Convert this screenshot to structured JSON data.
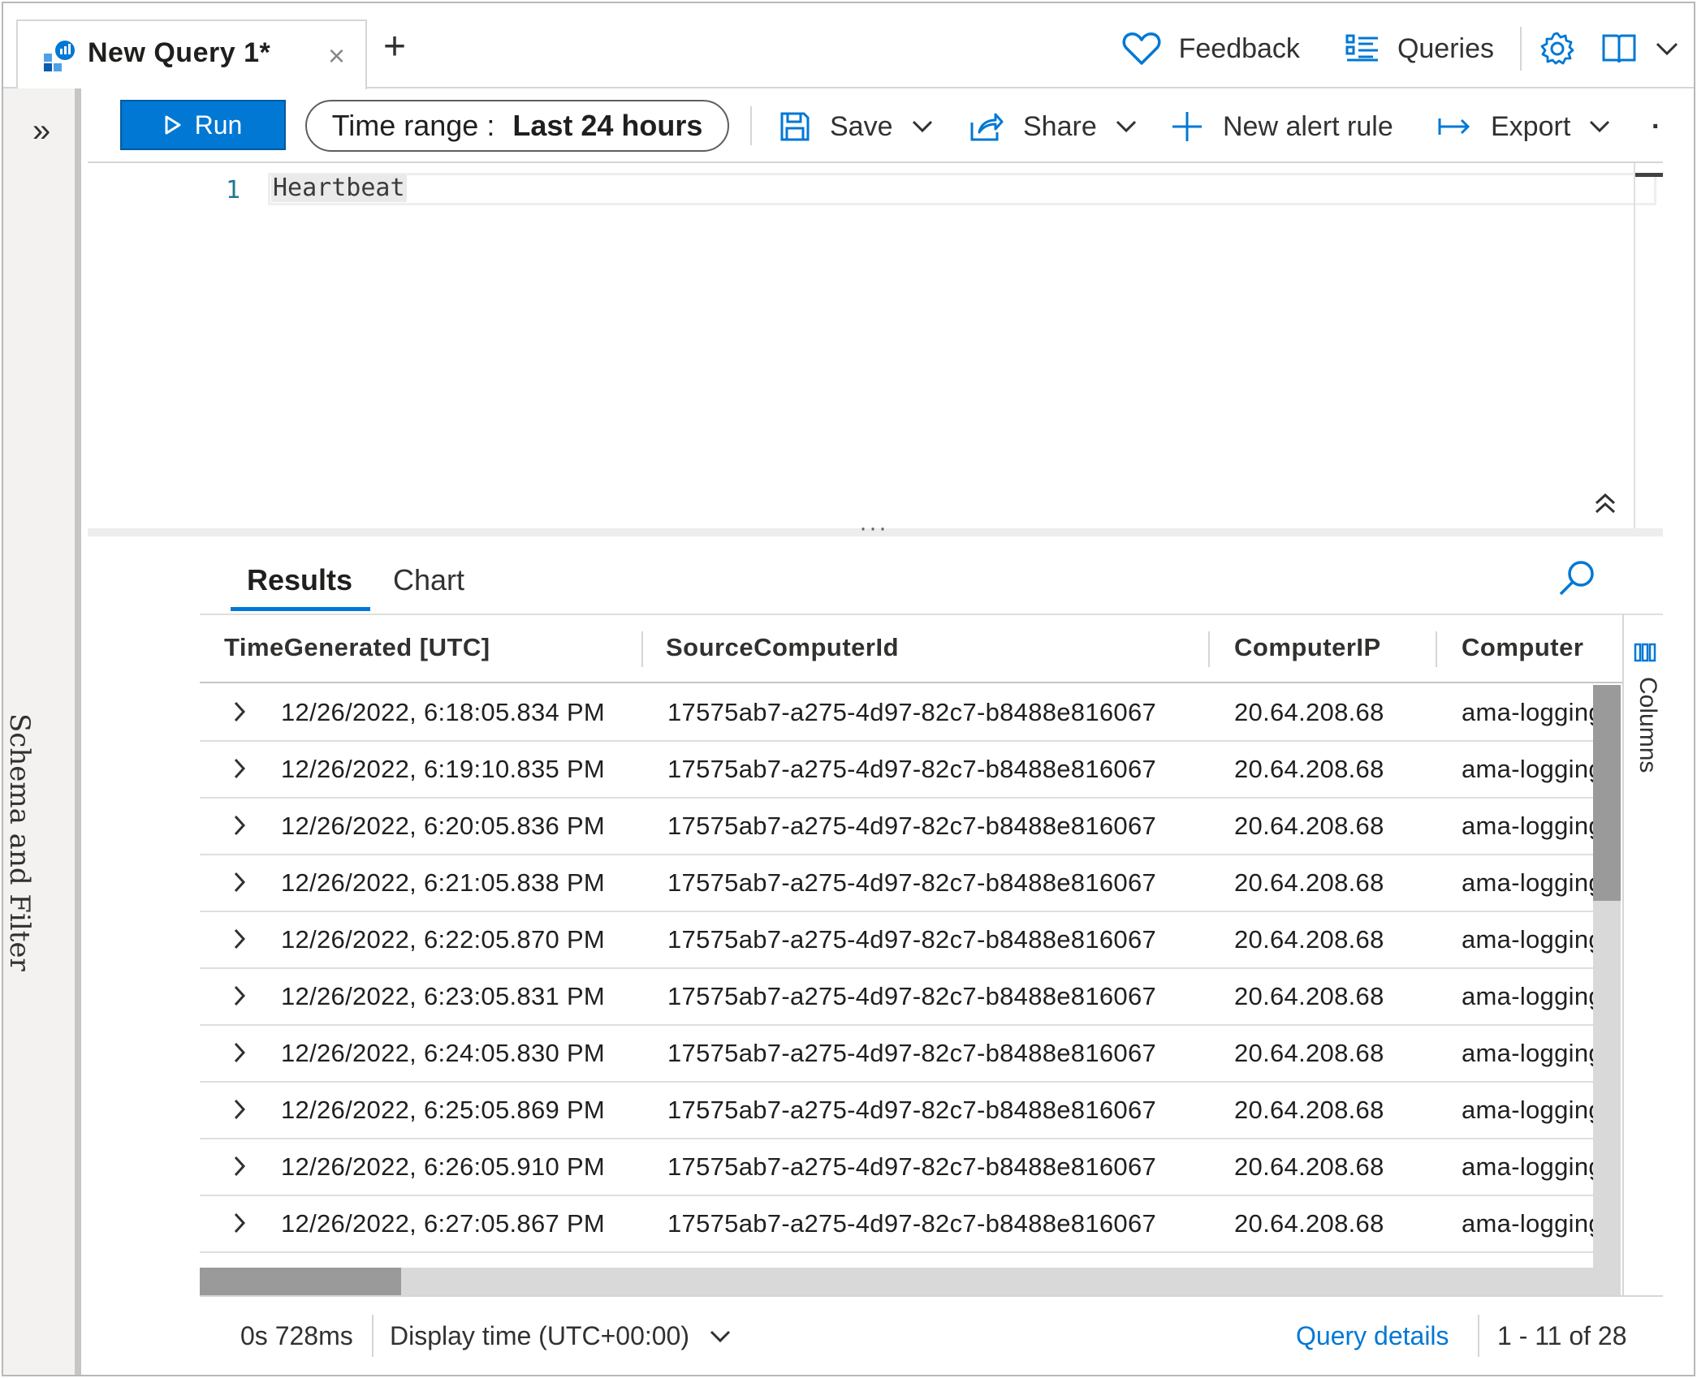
{
  "tab": {
    "title": "New Query 1*",
    "close": "×",
    "add": "+"
  },
  "top_actions": {
    "feedback": "Feedback",
    "queries": "Queries"
  },
  "left_panel": {
    "label": "Schema and Filter",
    "expand": "»"
  },
  "toolbar": {
    "run": "Run",
    "time_range_label": "Time range :",
    "time_range_value": "Last 24 hours",
    "save": "Save",
    "share": "Share",
    "new_alert_rule": "New alert rule",
    "export": "Export",
    "more": "·"
  },
  "editor": {
    "line_number": "1",
    "code": "Heartbeat"
  },
  "results": {
    "tabs": [
      {
        "label": "Results"
      },
      {
        "label": "Chart"
      }
    ],
    "columns": [
      "TimeGenerated [UTC]",
      "SourceComputerId",
      "ComputerIP",
      "Computer"
    ],
    "rows": [
      [
        "12/26/2022, 6:18:05.834 PM",
        "17575ab7-a275-4d97-82c7-b8488e816067",
        "20.64.208.68",
        "ama-logging"
      ],
      [
        "12/26/2022, 6:19:10.835 PM",
        "17575ab7-a275-4d97-82c7-b8488e816067",
        "20.64.208.68",
        "ama-logging"
      ],
      [
        "12/26/2022, 6:20:05.836 PM",
        "17575ab7-a275-4d97-82c7-b8488e816067",
        "20.64.208.68",
        "ama-logging"
      ],
      [
        "12/26/2022, 6:21:05.838 PM",
        "17575ab7-a275-4d97-82c7-b8488e816067",
        "20.64.208.68",
        "ama-logging"
      ],
      [
        "12/26/2022, 6:22:05.870 PM",
        "17575ab7-a275-4d97-82c7-b8488e816067",
        "20.64.208.68",
        "ama-logging"
      ],
      [
        "12/26/2022, 6:23:05.831 PM",
        "17575ab7-a275-4d97-82c7-b8488e816067",
        "20.64.208.68",
        "ama-logging"
      ],
      [
        "12/26/2022, 6:24:05.830 PM",
        "17575ab7-a275-4d97-82c7-b8488e816067",
        "20.64.208.68",
        "ama-logging"
      ],
      [
        "12/26/2022, 6:25:05.869 PM",
        "17575ab7-a275-4d97-82c7-b8488e816067",
        "20.64.208.68",
        "ama-logging"
      ],
      [
        "12/26/2022, 6:26:05.910 PM",
        "17575ab7-a275-4d97-82c7-b8488e816067",
        "20.64.208.68",
        "ama-logging"
      ],
      [
        "12/26/2022, 6:27:05.867 PM",
        "17575ab7-a275-4d97-82c7-b8488e816067",
        "20.64.208.68",
        "ama-logging"
      ]
    ],
    "columns_panel_label": "Columns"
  },
  "status": {
    "duration": "0s 728ms",
    "display_time": "Display time (UTC+00:00)",
    "query_details": "Query details",
    "count": "1 - 11 of 28"
  },
  "colors": {
    "accent": "#0078d4",
    "text": "#201f1e",
    "border": "#d6d6d6"
  }
}
